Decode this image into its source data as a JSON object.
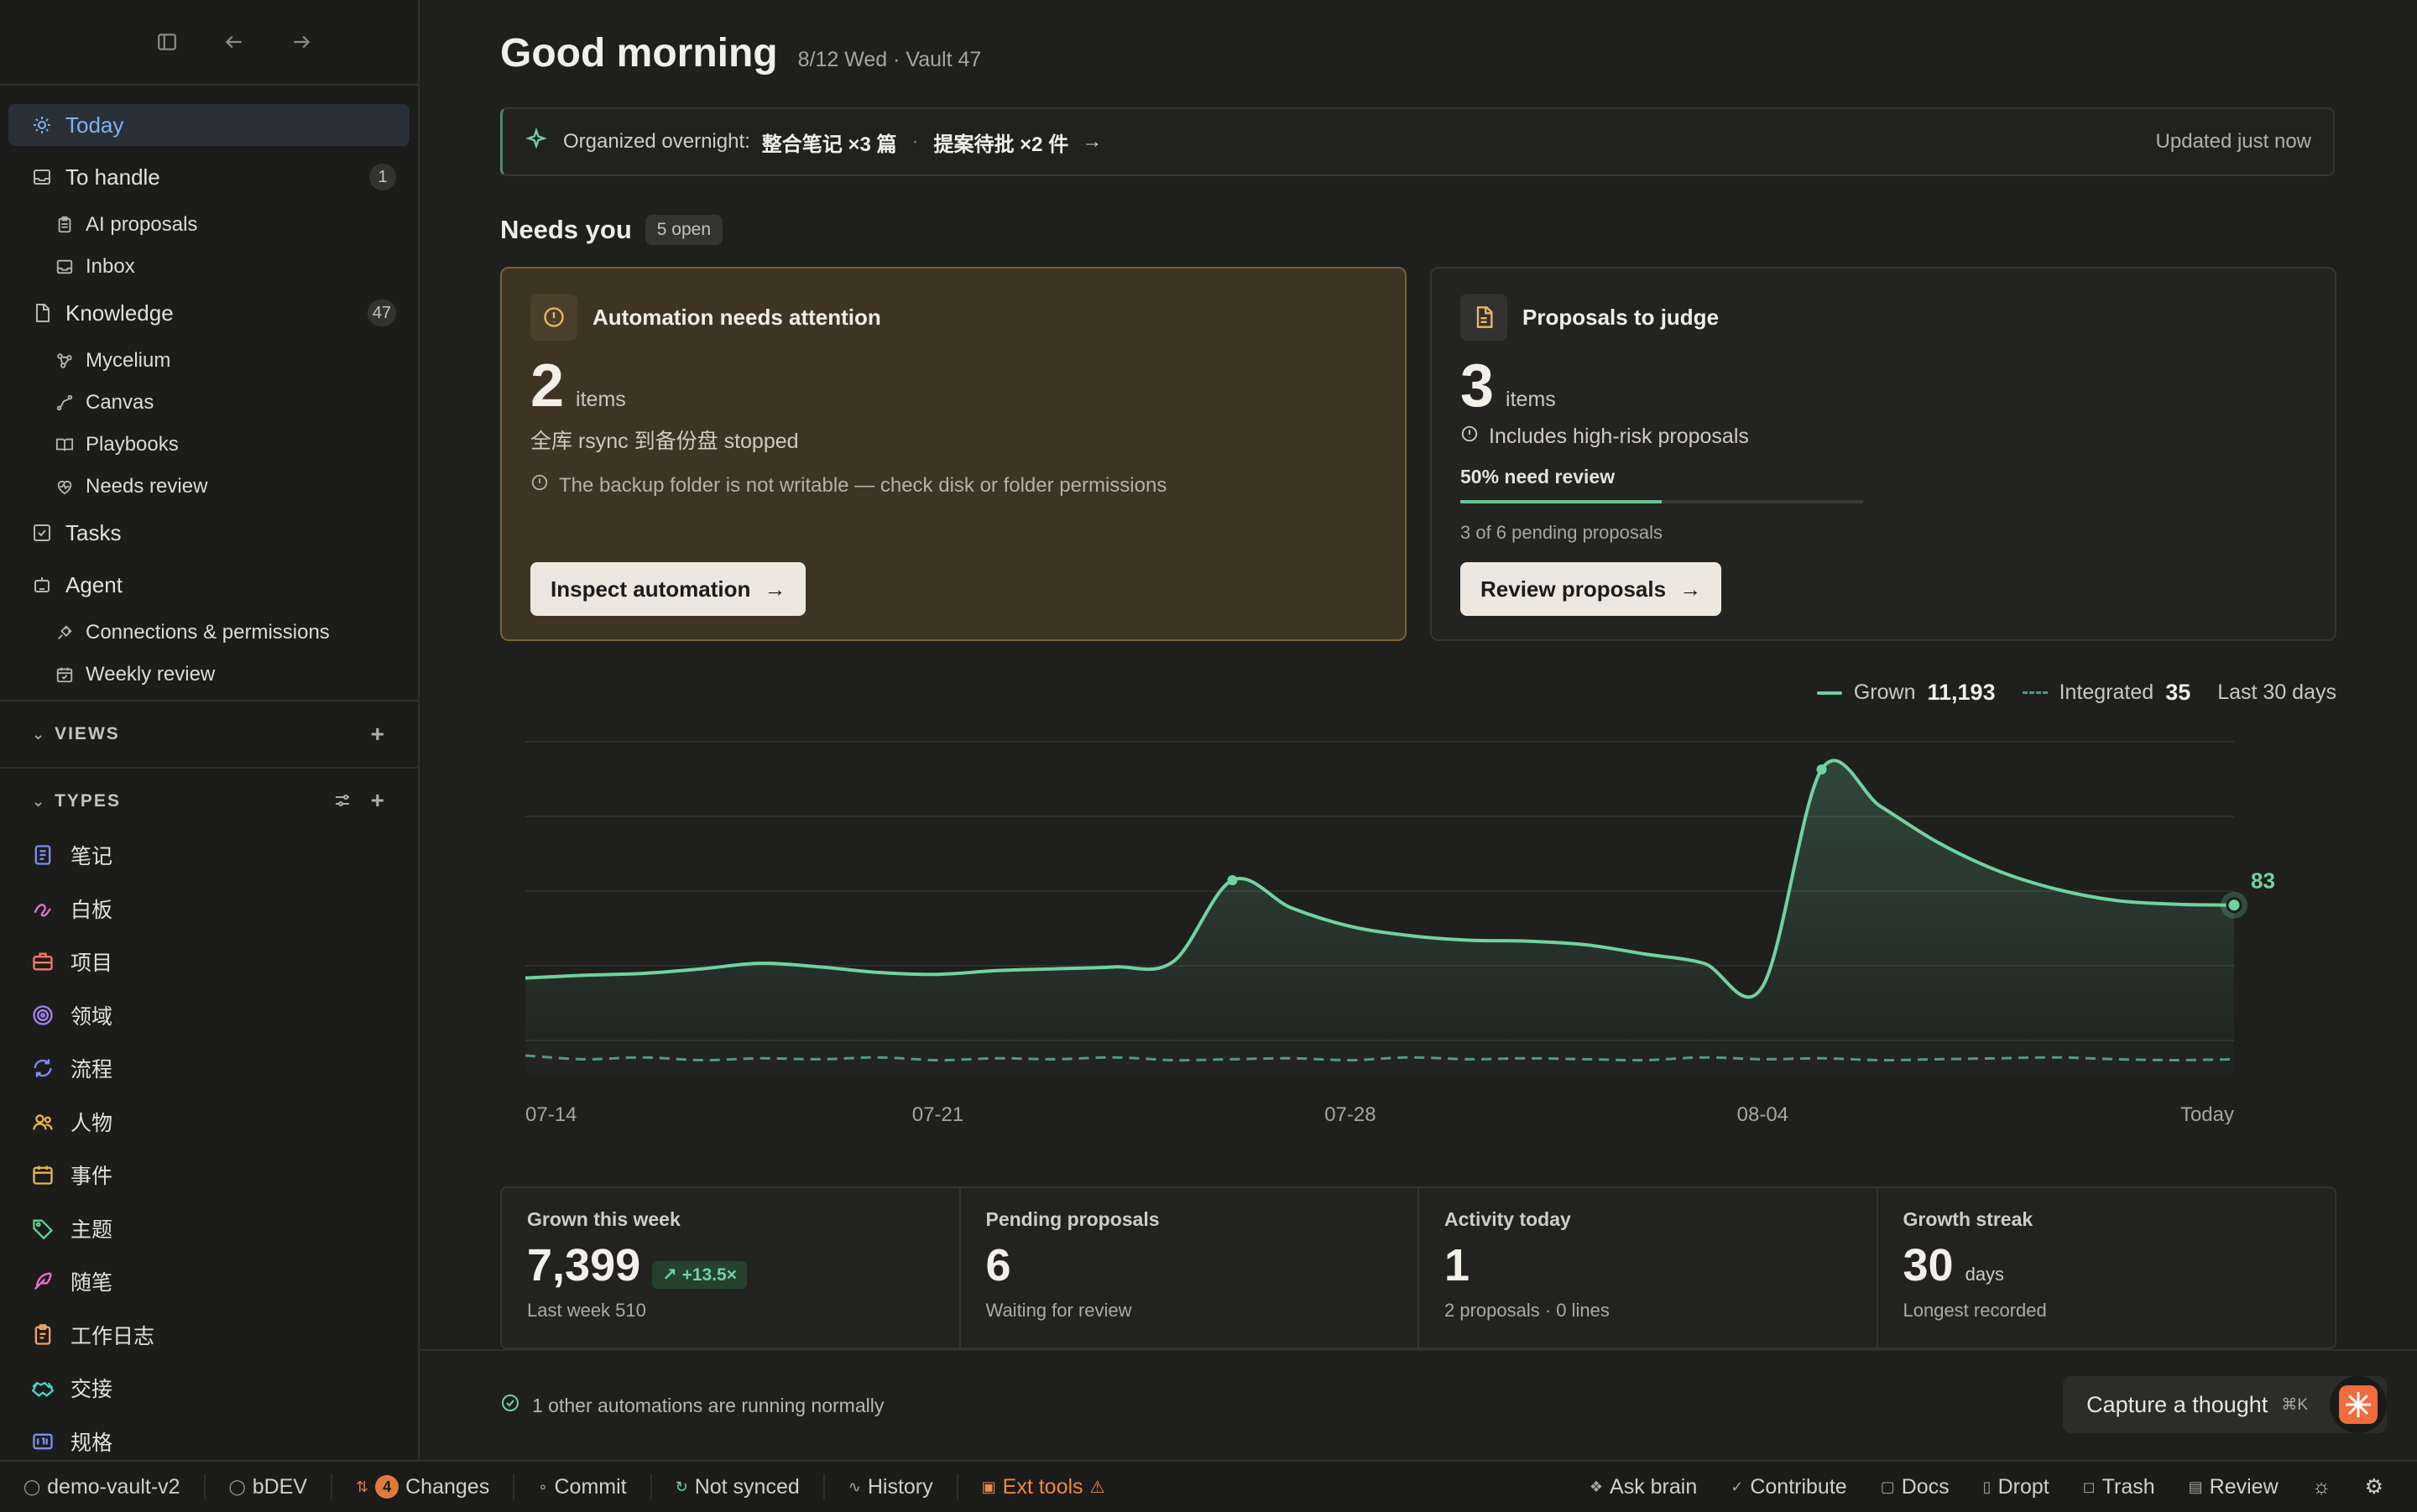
{
  "sidebar": {
    "nav": [
      {
        "label": "Today",
        "active": true,
        "icon": "sun-icon"
      },
      {
        "label": "To handle",
        "count": "1",
        "icon": "inbox-icon",
        "children": [
          {
            "label": "AI proposals",
            "icon": "clipboard-icon"
          },
          {
            "label": "Inbox",
            "icon": "inbox-icon"
          }
        ]
      },
      {
        "label": "Knowledge",
        "count": "47",
        "icon": "doc-icon",
        "children": [
          {
            "label": "Mycelium",
            "icon": "graph-icon"
          },
          {
            "label": "Canvas",
            "icon": "path-icon"
          },
          {
            "label": "Playbooks",
            "icon": "book-icon"
          },
          {
            "label": "Needs review",
            "icon": "heart-pulse-icon"
          }
        ]
      },
      {
        "label": "Tasks",
        "icon": "checkbox-icon"
      },
      {
        "label": "Agent",
        "icon": "robot-icon",
        "children": [
          {
            "label": "Connections & permissions",
            "icon": "plug-icon"
          },
          {
            "label": "Weekly review",
            "icon": "calendar-check-icon"
          }
        ]
      }
    ],
    "views_label": "VIEWS",
    "types_label": "TYPES",
    "types": [
      {
        "label": "笔记",
        "color": "#7d8cf5",
        "icon": "note-icon"
      },
      {
        "label": "白板",
        "color": "#e86fc7",
        "icon": "scribble-icon"
      },
      {
        "label": "项目",
        "color": "#f07a68",
        "icon": "briefcase-icon"
      },
      {
        "label": "领域",
        "color": "#a883f0",
        "icon": "target-icon"
      },
      {
        "label": "流程",
        "color": "#7d8cf5",
        "icon": "refresh-icon"
      },
      {
        "label": "人物",
        "color": "#e9b452",
        "icon": "people-icon"
      },
      {
        "label": "事件",
        "color": "#e9b452",
        "icon": "calendar-icon"
      },
      {
        "label": "主题",
        "color": "#5fd28f",
        "icon": "tag-icon"
      },
      {
        "label": "随笔",
        "color": "#e86fc7",
        "icon": "feather-icon"
      },
      {
        "label": "工作日志",
        "color": "#f0a060",
        "icon": "log-icon"
      },
      {
        "label": "交接",
        "color": "#4fd1c5",
        "icon": "handshake-icon"
      },
      {
        "label": "规格",
        "color": "#7d8cf5",
        "icon": "spec-icon"
      }
    ]
  },
  "header": {
    "title": "Good morning",
    "date": "8/12 Wed",
    "vault": "Vault 47"
  },
  "banner": {
    "prefix": "Organized overnight:",
    "item1": "整合笔记 ×3 篇",
    "item2": "提案待批 ×2 件",
    "updated": "Updated just now"
  },
  "needs": {
    "title": "Needs you",
    "pill": "5 open"
  },
  "card_auto": {
    "title": "Automation needs attention",
    "count": "2",
    "unit": "items",
    "line1": "全库 rsync 到备份盘 stopped",
    "line2": "The backup folder is not writable — check disk or folder permissions",
    "button": "Inspect automation"
  },
  "card_prop": {
    "title": "Proposals to judge",
    "count": "3",
    "unit": "items",
    "line1": "Includes high-risk proposals",
    "progress_label": "50% need review",
    "progress": 0.5,
    "progress_sub": "3 of 6 pending proposals",
    "button": "Review proposals"
  },
  "legend": {
    "grown_label": "Grown",
    "grown_value": "11,193",
    "integrated_label": "Integrated",
    "integrated_value": "35",
    "range": "Last 30 days"
  },
  "chart_data": {
    "type": "area",
    "x": [
      "07-14",
      "07-15",
      "07-16",
      "07-17",
      "07-18",
      "07-19",
      "07-20",
      "07-21",
      "07-22",
      "07-23",
      "07-24",
      "07-25",
      "07-26",
      "07-27",
      "07-28",
      "07-29",
      "07-30",
      "07-31",
      "08-01",
      "08-02",
      "08-03",
      "08-04",
      "08-05",
      "08-06",
      "08-07",
      "08-08",
      "08-09",
      "08-10",
      "08-11",
      "Today"
    ],
    "x_tick_labels": [
      "07-14",
      "07-21",
      "07-28",
      "08-04",
      "Today"
    ],
    "series": [
      {
        "name": "Grown",
        "values": [
          4,
          7,
          9,
          14,
          20,
          16,
          10,
          8,
          12,
          14,
          16,
          22,
          110,
          80,
          60,
          50,
          45,
          44,
          40,
          30,
          20,
          -5,
          230,
          190,
          150,
          120,
          100,
          88,
          84,
          83
        ]
      },
      {
        "name": "Integrated",
        "values": [
          -80,
          -84,
          -82,
          -85,
          -83,
          -84,
          -82,
          -85,
          -83,
          -84,
          -82,
          -85,
          -84,
          -83,
          -85,
          -82,
          -84,
          -83,
          -84,
          -85,
          -82,
          -84,
          -83,
          -85,
          -84,
          -83,
          -82,
          -84,
          -85,
          -84
        ]
      }
    ],
    "end_label": "83",
    "ylim": [
      -100,
      260
    ],
    "grid": true
  },
  "stats": [
    {
      "label": "Grown this week",
      "value": "7,399",
      "delta": "+13.5×",
      "sub": "Last week 510"
    },
    {
      "label": "Pending proposals",
      "value": "6",
      "sub": "Waiting for review"
    },
    {
      "label": "Activity today",
      "value": "1",
      "sub": "2 proposals · 0 lines"
    },
    {
      "label": "Growth streak",
      "value": "30",
      "unit": "days",
      "sub": "Longest recorded"
    }
  ],
  "footer": {
    "ok_message": "1 other automations are running normally",
    "capture": "Capture a thought",
    "capture_key": "⌘K"
  },
  "statusbar": {
    "vault": "demo-vault-v2",
    "branch": "bDEV",
    "changes_count": "4",
    "changes": "Changes",
    "commit": "Commit",
    "sync": "Not synced",
    "history": "History",
    "ext": "Ext tools",
    "right": [
      "Ask brain",
      "Contribute",
      "Docs",
      "Dropt",
      "Trash",
      "Review"
    ]
  },
  "colors": {
    "accent": "#6fd3a0",
    "warning": "#e9b967",
    "active_nav": "#7fb2f0"
  }
}
